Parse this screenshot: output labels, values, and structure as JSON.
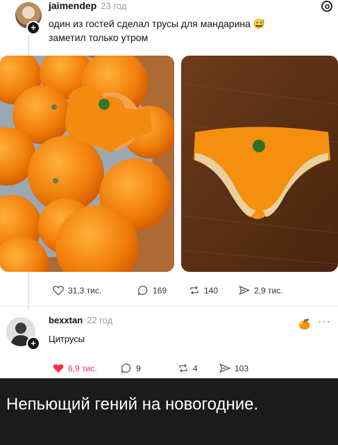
{
  "post1": {
    "username": "jaimendep",
    "time": "23 год",
    "line1": "один из гостей сделал трусы для мандарина 😅",
    "line2": "заметил только утром",
    "stats": {
      "likes": "31,3 тис.",
      "comments": "169",
      "reposts": "140",
      "shares": "2,9 тис."
    }
  },
  "post2": {
    "username": "bexxtan",
    "time": "22 год",
    "text": "Цитрусы",
    "stats": {
      "likes": "6,9 тис.",
      "comments": "9",
      "reposts": "4",
      "shares": "103"
    }
  },
  "caption": "Непьющий гений на новогодние.",
  "colors": {
    "like_active": "#ff3040",
    "caption_bg": "#1b1b1b",
    "orange": "#f08a12"
  },
  "icons": [
    "threads-icon",
    "heart-icon",
    "comment-icon",
    "repost-icon",
    "share-icon",
    "more-icon",
    "plus-icon"
  ]
}
